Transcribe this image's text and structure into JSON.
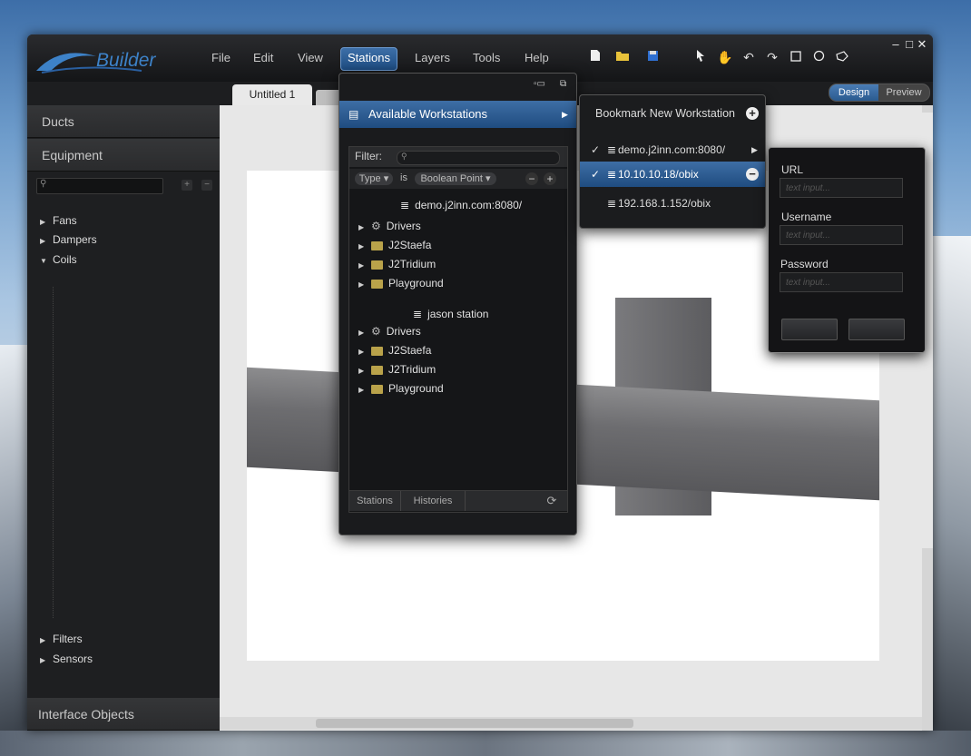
{
  "app": {
    "name": "Builder"
  },
  "menu": [
    "File",
    "Edit",
    "View",
    "Stations",
    "Layers",
    "Tools",
    "Help"
  ],
  "active_menu": "Stations",
  "toolbar_icons": [
    "new-document-icon",
    "open-folder-icon",
    "save-icon",
    "pointer-icon",
    "hand-icon",
    "undo-icon",
    "redo-icon",
    "rectangle-icon",
    "circle-icon",
    "polygon-icon"
  ],
  "window_controls": {
    "minimize": "–",
    "maximize": "□",
    "close": "✕"
  },
  "document_tab": "Untitled 1",
  "modes": {
    "design": "Design",
    "preview": "Preview"
  },
  "sidebar": {
    "ducts": "Ducts",
    "equipment": "Equipment",
    "items": [
      {
        "label": "Fans",
        "expanded": false
      },
      {
        "label": "Dampers",
        "expanded": false
      },
      {
        "label": "Coils",
        "expanded": true
      },
      {
        "label": "Filters",
        "expanded": false
      },
      {
        "label": "Sensors",
        "expanded": false
      }
    ],
    "interface_objects": "Interface Objects"
  },
  "stations_panel": {
    "header": "Available Workstations",
    "filter_label": "Filter:",
    "type_pill": "Type",
    "is_text": "is",
    "value_pill": "Boolean Point",
    "stations": [
      {
        "name": "demo.j2inn.com:8080/",
        "children": [
          "Drivers",
          "J2Staefa",
          "J2Tridium",
          "Playground"
        ]
      },
      {
        "name": "jason station",
        "children": [
          "Drivers",
          "J2Staefa",
          "J2Tridium",
          "Playground"
        ]
      }
    ],
    "tabs": [
      "Stations",
      "Histories"
    ]
  },
  "workstations": {
    "bookmark": "Bookmark New Workstation",
    "items": [
      {
        "label": "demo.j2inn.com:8080/",
        "checked": true
      },
      {
        "label": "10.10.10.18/obix",
        "checked": true,
        "selected": true
      },
      {
        "label": "192.168.1.152/obix",
        "checked": false
      }
    ]
  },
  "login": {
    "url_label": "URL",
    "username_label": "Username",
    "password_label": "Password",
    "placeholder": "text input..."
  }
}
